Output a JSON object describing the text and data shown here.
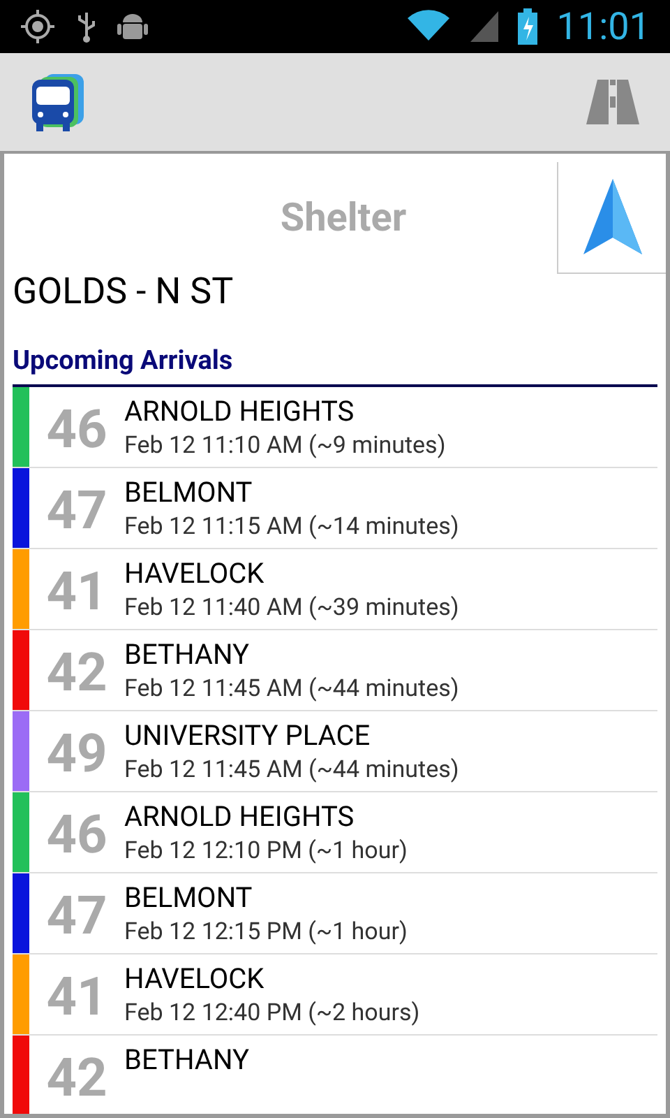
{
  "status_bar": {
    "time": "11:01"
  },
  "header": {
    "title": "Shelter"
  },
  "stop": {
    "name": "GOLDS - N ST"
  },
  "section_title": "Upcoming Arrivals",
  "arrivals": [
    {
      "route": "46",
      "name": "ARNOLD HEIGHTS",
      "time": "Feb 12 11:10 AM (~9 minutes)",
      "color": "#22c05a"
    },
    {
      "route": "47",
      "name": "BELMONT",
      "time": "Feb 12 11:15 AM (~14 minutes)",
      "color": "#0a14dc"
    },
    {
      "route": "41",
      "name": "HAVELOCK",
      "time": "Feb 12 11:40 AM (~39 minutes)",
      "color": "#ff9c00"
    },
    {
      "route": "42",
      "name": "BETHANY",
      "time": "Feb 12 11:45 AM (~44 minutes)",
      "color": "#f00a0a"
    },
    {
      "route": "49",
      "name": "UNIVERSITY PLACE",
      "time": "Feb 12 11:45 AM (~44 minutes)",
      "color": "#9b6cf5"
    },
    {
      "route": "46",
      "name": "ARNOLD HEIGHTS",
      "time": "Feb 12 12:10 PM (~1 hour)",
      "color": "#22c05a"
    },
    {
      "route": "47",
      "name": "BELMONT",
      "time": "Feb 12 12:15 PM (~1 hour)",
      "color": "#0a14dc"
    },
    {
      "route": "41",
      "name": "HAVELOCK",
      "time": "Feb 12 12:40 PM (~2 hours)",
      "color": "#ff9c00"
    },
    {
      "route": "42",
      "name": "BETHANY",
      "color": "#f00a0a"
    }
  ]
}
